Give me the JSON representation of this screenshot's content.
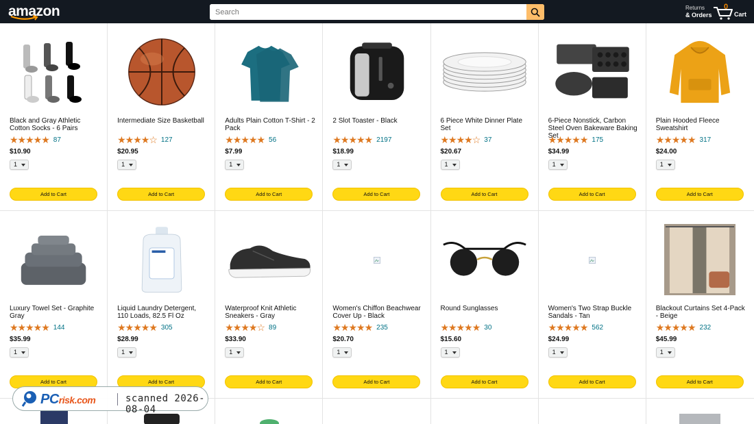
{
  "header": {
    "logo": "amazon",
    "search_placeholder": "Search",
    "returns_line1": "Returns",
    "returns_line2": "& Orders",
    "cart_count": "0",
    "cart_label": "Cart"
  },
  "add_to_cart_label": "Add to Cart",
  "products": [
    {
      "title": "Black and Gray Athletic Cotton Socks - 6 Pairs",
      "rating": 4.5,
      "stars": "★★★★★",
      "reviews": "87",
      "price": "$10.90",
      "qty": "1",
      "icon": "socks-image"
    },
    {
      "title": "Intermediate Size Basketball",
      "rating": 4.0,
      "stars": "★★★★☆",
      "reviews": "127",
      "price": "$20.95",
      "qty": "1",
      "icon": "basketball-image"
    },
    {
      "title": "Adults Plain Cotton T-Shirt - 2 Pack",
      "rating": 4.5,
      "stars": "★★★★★",
      "reviews": "56",
      "price": "$7.99",
      "qty": "1",
      "icon": "tshirt-image"
    },
    {
      "title": "2 Slot Toaster - Black",
      "rating": 5.0,
      "stars": "★★★★★",
      "reviews": "2197",
      "price": "$18.99",
      "qty": "1",
      "icon": "toaster-image"
    },
    {
      "title": "6 Piece White Dinner Plate Set",
      "rating": 4.0,
      "stars": "★★★★☆",
      "reviews": "37",
      "price": "$20.67",
      "qty": "1",
      "icon": "plates-image"
    },
    {
      "title": "6-Piece Nonstick, Carbon Steel Oven Bakeware Baking Set",
      "rating": 4.5,
      "stars": "★★★★★",
      "reviews": "175",
      "price": "$34.99",
      "qty": "1",
      "icon": "bakeware-image"
    },
    {
      "title": "Plain Hooded Fleece Sweatshirt",
      "rating": 4.5,
      "stars": "★★★★★",
      "reviews": "317",
      "price": "$24.00",
      "qty": "1",
      "icon": "hoodie-image"
    },
    {
      "title": "Luxury Towel Set - Graphite Gray",
      "rating": 4.5,
      "stars": "★★★★★",
      "reviews": "144",
      "price": "$35.99",
      "qty": "1",
      "icon": "towels-image"
    },
    {
      "title": "Liquid Laundry Detergent, 110 Loads, 82.5 Fl Oz",
      "rating": 4.5,
      "stars": "★★★★★",
      "reviews": "305",
      "price": "$28.99",
      "qty": "1",
      "icon": "detergent-image"
    },
    {
      "title": "Waterproof Knit Athletic Sneakers - Gray",
      "rating": 4.0,
      "stars": "★★★★☆",
      "reviews": "89",
      "price": "$33.90",
      "qty": "1",
      "icon": "sneaker-image"
    },
    {
      "title": "Women's Chiffon Beachwear Cover Up - Black",
      "rating": 4.5,
      "stars": "★★★★★",
      "reviews": "235",
      "price": "$20.70",
      "qty": "1",
      "icon": "broken-image"
    },
    {
      "title": "Round Sunglasses",
      "rating": 4.5,
      "stars": "★★★★★",
      "reviews": "30",
      "price": "$15.60",
      "qty": "1",
      "icon": "sunglasses-image"
    },
    {
      "title": "Women's Two Strap Buckle Sandals - Tan",
      "rating": 4.5,
      "stars": "★★★★★",
      "reviews": "562",
      "price": "$24.99",
      "qty": "1",
      "icon": "broken-image"
    },
    {
      "title": "Blackout Curtains Set 4-Pack - Beige",
      "rating": 4.5,
      "stars": "★★★★★",
      "reviews": "232",
      "price": "$45.99",
      "qty": "1",
      "icon": "curtains-image"
    }
  ],
  "watermark": {
    "brand_pc": "PC",
    "brand_risk": "risk.com",
    "scan_text": "scanned 2026-08-04"
  }
}
